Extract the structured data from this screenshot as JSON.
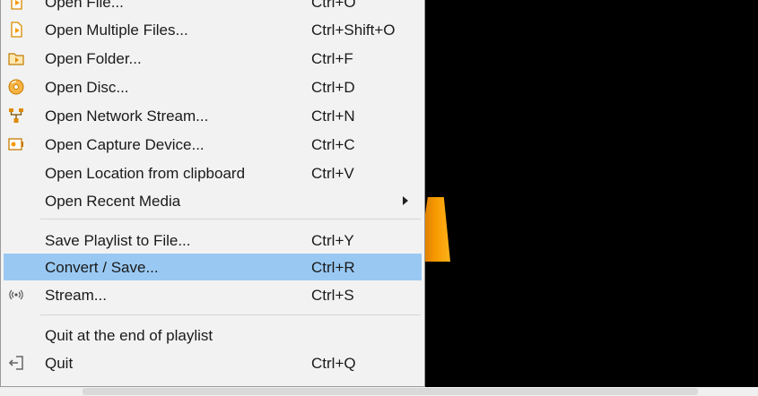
{
  "menu": {
    "items": [
      {
        "label": "Open File...",
        "shortcut": "Ctrl+O",
        "icon": "file-play-icon"
      },
      {
        "label": "Open Multiple Files...",
        "shortcut": "Ctrl+Shift+O",
        "icon": "file-play-icon"
      },
      {
        "label": "Open Folder...",
        "shortcut": "Ctrl+F",
        "icon": "folder-icon"
      },
      {
        "label": "Open Disc...",
        "shortcut": "Ctrl+D",
        "icon": "disc-icon"
      },
      {
        "label": "Open Network Stream...",
        "shortcut": "Ctrl+N",
        "icon": "network-icon"
      },
      {
        "label": "Open Capture Device...",
        "shortcut": "Ctrl+C",
        "icon": "capture-device-icon"
      },
      {
        "label": "Open Location from clipboard",
        "shortcut": "Ctrl+V"
      },
      {
        "label": "Open Recent Media",
        "shortcut": "",
        "submenu": true
      },
      {
        "label": "Save Playlist to File...",
        "shortcut": "Ctrl+Y"
      },
      {
        "label": "Convert / Save...",
        "shortcut": "Ctrl+R",
        "highlighted": true
      },
      {
        "label": "Stream...",
        "shortcut": "Ctrl+S",
        "icon": "stream-icon"
      },
      {
        "label": "Quit at the end of playlist",
        "shortcut": ""
      },
      {
        "label": "Quit",
        "shortcut": "Ctrl+Q",
        "icon": "quit-icon"
      }
    ]
  },
  "colors": {
    "menu_bg": "#f2f2f2",
    "highlight": "#99c9f3",
    "accent_orange": "#f79a00",
    "background": "#000000"
  }
}
